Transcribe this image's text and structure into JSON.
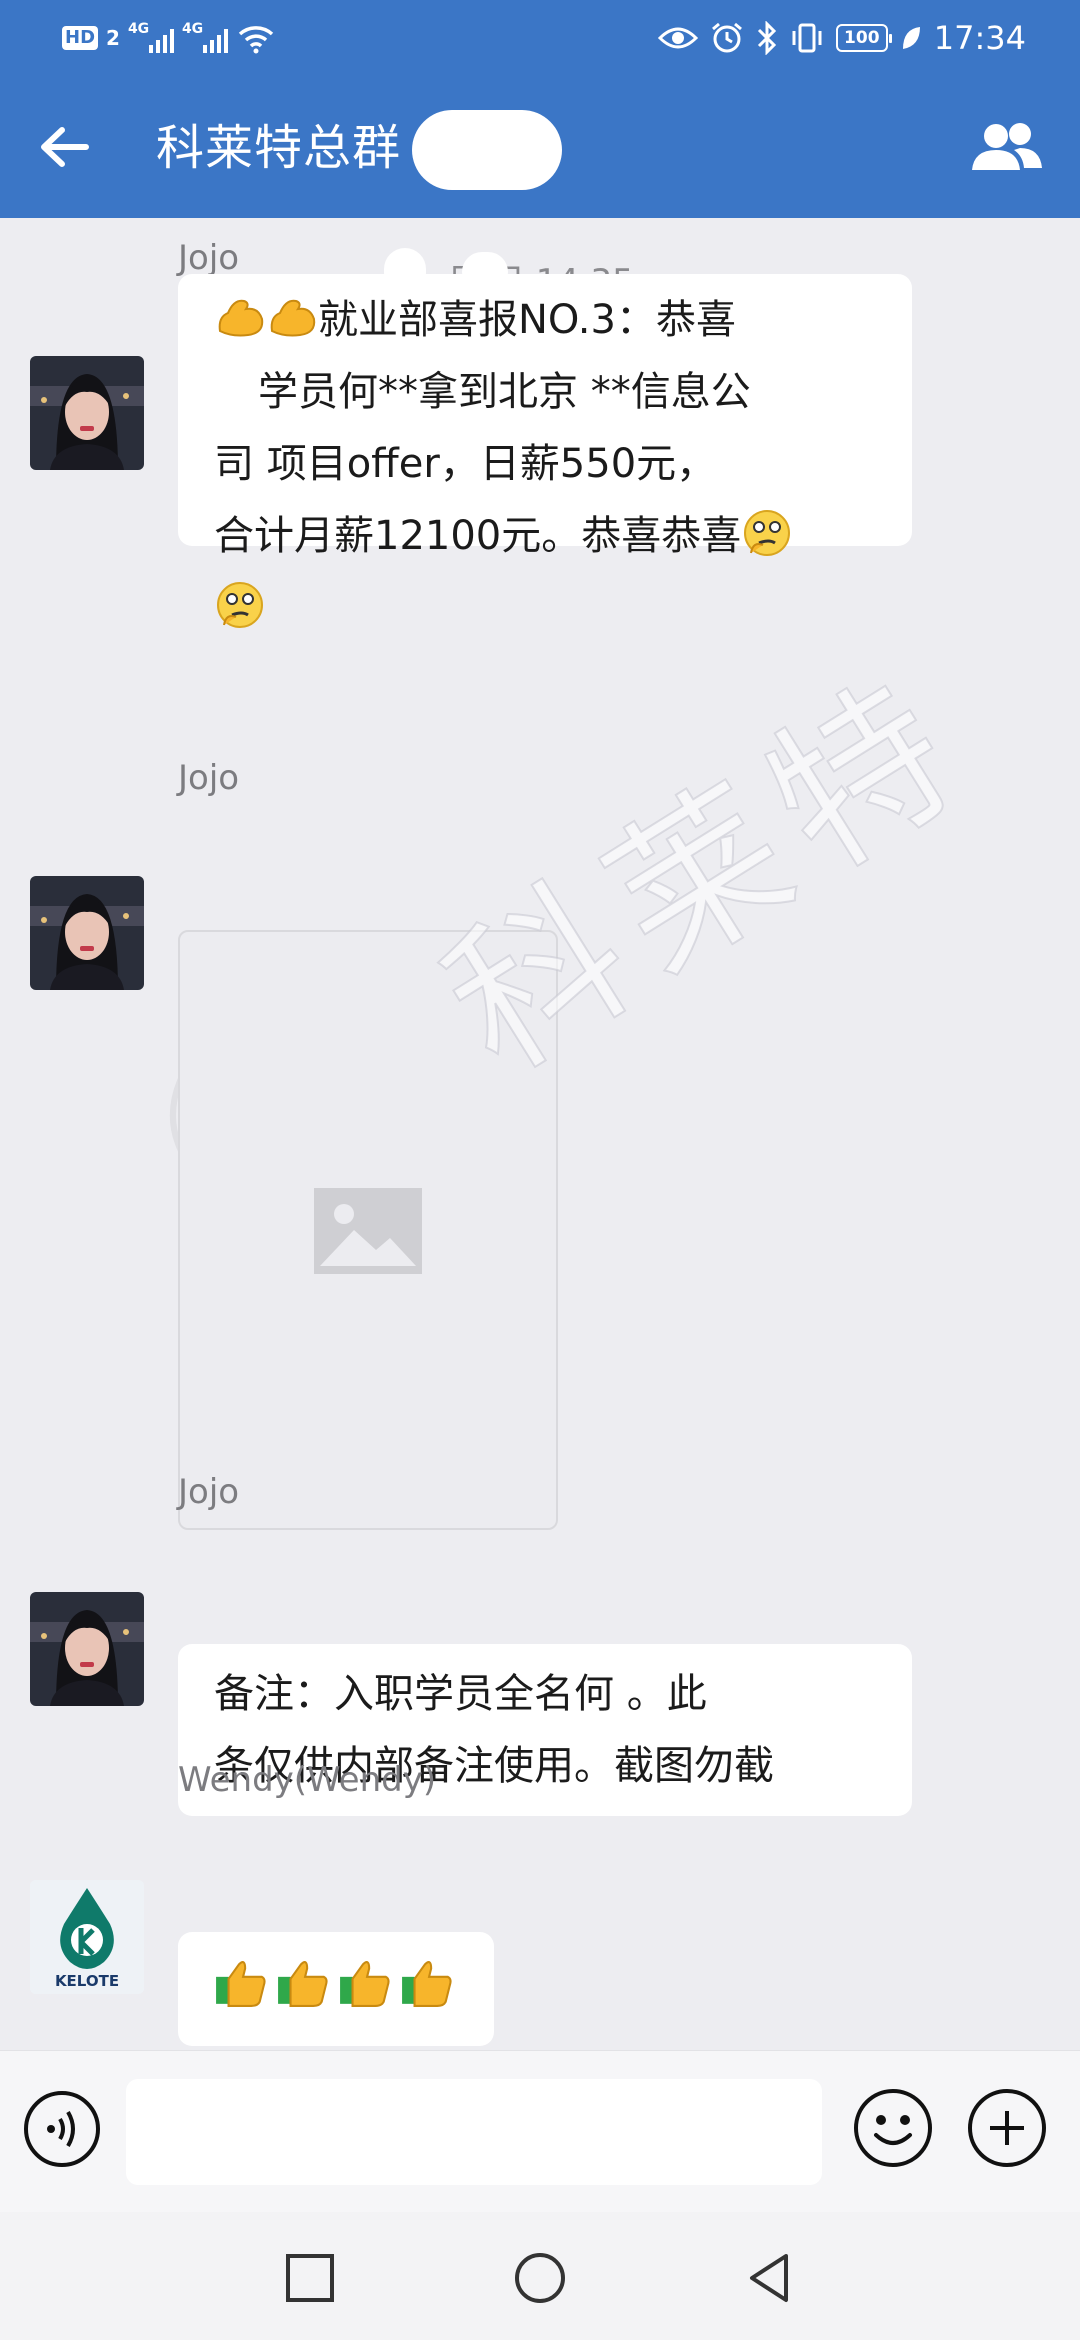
{
  "status_bar": {
    "hd_label": "HD",
    "sim_number": "2",
    "network_1": "4G",
    "network_2": "4G",
    "battery": "100",
    "time": "17:34"
  },
  "header": {
    "title": "科莱特总群",
    "back_icon": "arrow-left-icon",
    "members_icon": "group-members-icon"
  },
  "chat": {
    "timestamp": "月 日 14:35",
    "messages": [
      {
        "sender": "Jojo",
        "type": "text",
        "lines": [
          "就业部喜报NO.3：恭喜",
          "学员何**拿到北京 **信息公",
          "司 项目offer，日薪550元，",
          "合计月薪12100元。恭喜恭喜"
        ]
      },
      {
        "sender": "Jojo",
        "type": "image"
      },
      {
        "sender": "Jojo",
        "type": "text",
        "lines": [
          "备注：入职学员全名何 。此",
          "条仅供内部备注使用。截图勿截"
        ]
      },
      {
        "sender": "Wendy(Wendy)",
        "type": "emoji",
        "avatar_text": "KELOTE"
      }
    ],
    "watermark_text": "科莱特"
  },
  "input_bar": {
    "placeholder": "",
    "voice_icon": "voice-input-icon",
    "emoji_icon": "emoji-smile-icon",
    "plus_icon": "plus-circle-icon"
  },
  "colors": {
    "header_blue": "#3b76c6",
    "background": "#ededf1",
    "bubble": "#ffffff"
  }
}
